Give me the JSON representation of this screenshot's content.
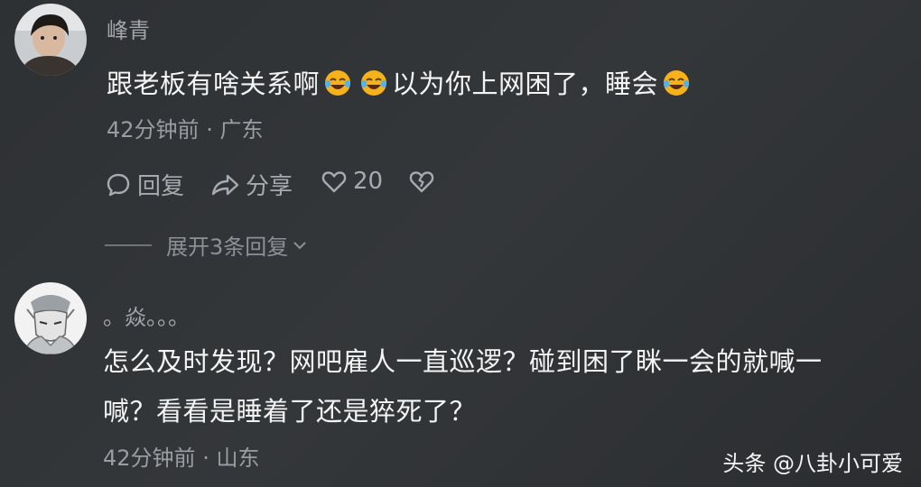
{
  "comments": [
    {
      "username": "峰青",
      "text_parts": [
        "跟老板有啥关系啊",
        "以为你上网困了，睡会"
      ],
      "emoji_icon": "laughing-tears-emoji",
      "time": "42分钟前",
      "dot": "·",
      "location": "广东",
      "reply_label": "回复",
      "share_label": "分享",
      "like_count": "20",
      "expand_label": "展开3条回复"
    },
    {
      "username": "。焱。。。",
      "text_lines": [
        "怎么及时发现？网吧雇人一直巡逻？碰到困了眯一会的就喊一",
        "喊？看看是睡着了还是猝死了？"
      ],
      "time": "42分钟前",
      "dot": "·",
      "location": "山东"
    }
  ],
  "watermark": "头条 @八卦小可爱",
  "colors": {
    "background": "#2e3134",
    "text": "#f4f4f4",
    "muted": "#9a9da1",
    "emoji": "#f5b21a"
  }
}
